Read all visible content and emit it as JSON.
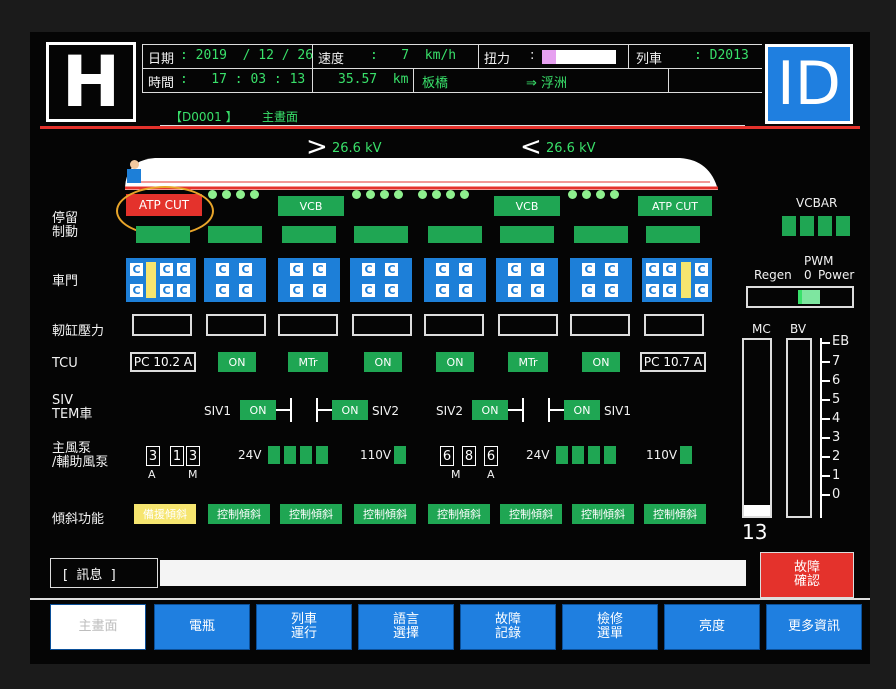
{
  "header": {
    "h_label": "H",
    "id_label": "ID",
    "date_label": "日期",
    "date_value": ": 2019  / 12 / 26",
    "time_label": "時間",
    "time_value": ":   17 : 03 : 13",
    "speed_label": "速度",
    "speed_value": ":   7  km/h",
    "distance_value": "35.57  km",
    "station_from": "板橋",
    "torque_label": "扭力",
    "torque_colon": ":",
    "direction_value": "⇒ 浮洲",
    "train_label": "列車",
    "train_value": ": D2013",
    "screen_code": "【D0001  】",
    "screen_title": "主畫面"
  },
  "voltage": {
    "left": "26.6 kV",
    "right": "26.6 kV"
  },
  "rows": {
    "parking_brake": "停留\n制動",
    "doors": "車門",
    "cylinder": "軔缸壓力",
    "tcu": "TCU",
    "siv": "SIV\nTEM車",
    "compressor": "主風泵\n/輔助風泵",
    "tilt": "傾斜功能"
  },
  "top_labels": {
    "atp_left": "ATP CUT",
    "vcb1": "VCB",
    "vcb2": "VCB",
    "atp_right": "ATP CUT"
  },
  "tcu": [
    "PC 10.2 A",
    "ON",
    "MTr",
    "ON",
    "ON",
    "MTr",
    "ON",
    "PC 10.7 A"
  ],
  "siv": {
    "siv1_left": "SIV1",
    "on1": "ON",
    "on2": "ON",
    "siv2_left": "SIV2",
    "siv2_right": "SIV2",
    "on3": "ON",
    "on4": "ON",
    "siv1_right": "SIV1"
  },
  "compressor": {
    "left_digits": [
      "3",
      "1",
      "3"
    ],
    "left_sub": [
      "A",
      "M"
    ],
    "v24a": "24V",
    "v110a": "110V",
    "right_digits": [
      "6",
      "8",
      "6"
    ],
    "right_sub": [
      "M",
      "A"
    ],
    "v24b": "24V",
    "v110b": "110V"
  },
  "tilt": [
    "備援傾斜",
    "控制傾斜",
    "控制傾斜",
    "控制傾斜",
    "控制傾斜",
    "控制傾斜",
    "控制傾斜",
    "控制傾斜"
  ],
  "right_panel": {
    "vcbar": "VCBAR",
    "pwm": "PWM",
    "regen": "Regen",
    "zero": "0",
    "power": "Power",
    "mc": "MC",
    "bv": "BV",
    "mc_level": 0.06,
    "mc_value": "13",
    "scale": [
      "EB",
      "7",
      "6",
      "5",
      "4",
      "3",
      "2",
      "1",
      "0"
    ]
  },
  "message": {
    "label": "[  訊息  ]",
    "text": ""
  },
  "fault_btn": "故障\n確認",
  "footer": [
    "主畫面",
    "電瓶",
    "列車\n運行",
    "語言\n選擇",
    "故障\n記錄",
    "檢修\n選單",
    "亮度",
    "更多資訊"
  ],
  "colors": {
    "accent_blue": "#1f7fe0",
    "green": "#1fa653",
    "red": "#e4322c",
    "yellow": "#f6e56f"
  }
}
